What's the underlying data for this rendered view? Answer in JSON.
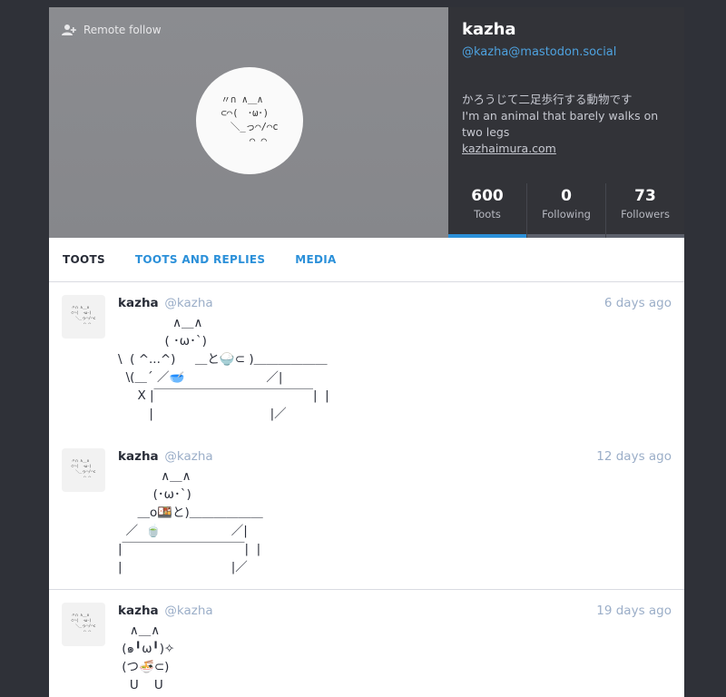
{
  "header": {
    "remote_follow_label": "Remote follow",
    "display_name": "kazha",
    "acct": "@kazha@mastodon.social",
    "bio_line1": "かろうじて二足歩行する動物です",
    "bio_line2": "I'm an animal that barely walks on two legs",
    "link": "kazhaimura.com",
    "avatar_art": "〃∩ ∧＿∧\n⊂⌒(　･ω･)\n　＼_っ⌒/⌒c\n　　　⌒ ⌒",
    "counters": [
      {
        "value": "600",
        "label": "Toots"
      },
      {
        "value": "0",
        "label": "Following"
      },
      {
        "value": "73",
        "label": "Followers"
      }
    ]
  },
  "tabs": [
    "TOOTS",
    "TOOTS AND REPLIES",
    "MEDIA"
  ],
  "statuses": [
    {
      "name": "kazha",
      "handle": "@kazha",
      "time": "6 days ago",
      "content": "              ∧＿∧\n            ( ･ω･`)\n\\  ( ^...^)     ＿と🍚⊂ )＿＿＿＿＿＿\n  \\(＿´ ／🥣                     ／|\n     X |￣￣￣￣￣￣￣￣￣￣￣￣￣|  |\n        |                              |／"
    },
    {
      "name": "kazha",
      "handle": "@kazha",
      "time": "12 days ago",
      "content": "           ∧＿∧\n         (･ω･`)\n     ＿o🍱と)＿＿＿＿＿＿\n  ／  🍵                  ／|\n|￣￣￣￣￣￣￣￣￣￣|  |\n|                            |／"
    },
    {
      "name": "kazha",
      "handle": "@kazha",
      "time": "19 days ago",
      "content": "   ∧＿∧\n (๑╹ω╹)✧\n (つ🍜⊂)\n   U    U"
    }
  ]
}
